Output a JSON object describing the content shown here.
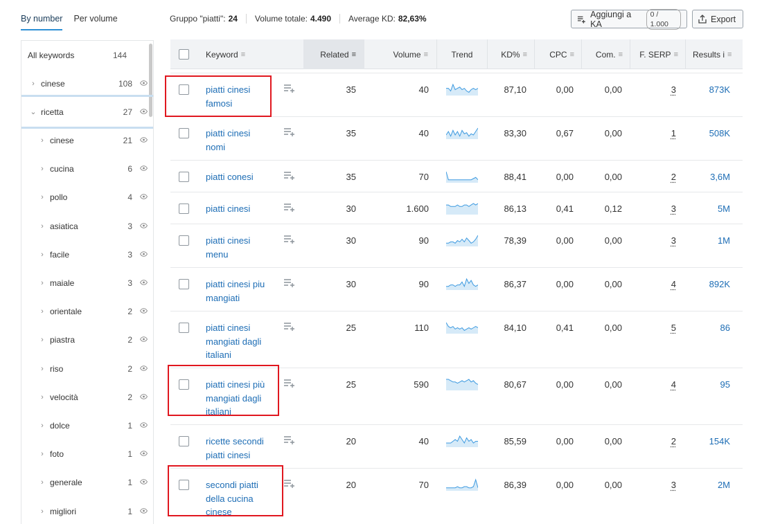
{
  "view_tabs": [
    {
      "label": "By number",
      "active": true
    },
    {
      "label": "Per volume",
      "active": false
    }
  ],
  "summary": {
    "group_label": "Gruppo \"piatti\":",
    "group_value": "24",
    "volume_label": "Volume totale:",
    "volume_value": "4.490",
    "kd_label": "Average KD:",
    "kd_value": "82,63%"
  },
  "toolbar": {
    "add_ka_label": "Aggiungi a KA",
    "add_ka_counter": "0 / 1.000",
    "export_label": "Export"
  },
  "groups": {
    "all": {
      "label": "All keywords",
      "count": "144"
    },
    "items": [
      {
        "label": "cinese",
        "count": "108",
        "level": 1,
        "expanded": false
      },
      {
        "label": "ricetta",
        "count": "27",
        "level": 1,
        "expanded": true
      },
      {
        "label": "cinese",
        "count": "21",
        "level": 2
      },
      {
        "label": "cucina",
        "count": "6",
        "level": 2
      },
      {
        "label": "pollo",
        "count": "4",
        "level": 2
      },
      {
        "label": "asiatica",
        "count": "3",
        "level": 2
      },
      {
        "label": "facile",
        "count": "3",
        "level": 2
      },
      {
        "label": "maiale",
        "count": "3",
        "level": 2
      },
      {
        "label": "orientale",
        "count": "2",
        "level": 2
      },
      {
        "label": "piastra",
        "count": "2",
        "level": 2
      },
      {
        "label": "riso",
        "count": "2",
        "level": 2
      },
      {
        "label": "velocità",
        "count": "2",
        "level": 2
      },
      {
        "label": "dolce",
        "count": "1",
        "level": 2
      },
      {
        "label": "foto",
        "count": "1",
        "level": 2
      },
      {
        "label": "generale",
        "count": "1",
        "level": 2
      },
      {
        "label": "migliori",
        "count": "1",
        "level": 2
      }
    ]
  },
  "table": {
    "columns": {
      "keyword": "Keyword",
      "related": "Related",
      "volume": "Volume",
      "trend": "Trend",
      "kd": "KD%",
      "cpc": "CPC",
      "com": "Com.",
      "serp": "F. SERP",
      "results": "Results i"
    },
    "rows": [
      {
        "keyword": [
          "piatti cinesi",
          "famosi"
        ],
        "related": "35",
        "volume": "40",
        "trend": [
          5,
          5,
          3,
          8,
          4,
          5,
          6,
          4,
          5,
          3,
          2,
          4,
          5,
          4,
          5
        ],
        "kd": "87,10",
        "cpc": "0,00",
        "com": "0,00",
        "serp": "3",
        "results": "873K",
        "highlighted": true
      },
      {
        "keyword": [
          "piatti cinesi",
          "nomi"
        ],
        "related": "35",
        "volume": "40",
        "trend": [
          3,
          6,
          2,
          7,
          3,
          6,
          2,
          7,
          4,
          5,
          2,
          4,
          3,
          6,
          9
        ],
        "kd": "83,30",
        "cpc": "0,67",
        "com": "0,00",
        "serp": "1",
        "results": "508K",
        "highlighted": false
      },
      {
        "keyword": [
          "piatti conesi"
        ],
        "related": "35",
        "volume": "70",
        "trend": [
          9,
          2,
          2,
          2,
          2,
          2,
          2,
          2,
          2,
          2,
          2,
          2,
          3,
          4,
          2
        ],
        "kd": "88,41",
        "cpc": "0,00",
        "com": "0,00",
        "serp": "2",
        "results": "3,6M",
        "highlighted": false
      },
      {
        "keyword": [
          "piatti cinesi"
        ],
        "related": "30",
        "volume": "1.600",
        "trend": [
          6,
          6,
          5,
          5,
          5,
          6,
          5,
          5,
          6,
          6,
          5,
          6,
          7,
          6,
          7
        ],
        "kd": "86,13",
        "cpc": "0,41",
        "com": "0,12",
        "serp": "3",
        "results": "5M",
        "highlighted": false
      },
      {
        "keyword": [
          "piatti cinesi",
          "menu"
        ],
        "related": "30",
        "volume": "90",
        "trend": [
          2,
          2,
          3,
          3,
          2,
          4,
          3,
          5,
          3,
          6,
          4,
          2,
          3,
          5,
          8
        ],
        "kd": "78,39",
        "cpc": "0,00",
        "com": "0,00",
        "serp": "3",
        "results": "1M",
        "highlighted": false
      },
      {
        "keyword": [
          "piatti cinesi piu",
          "mangiati"
        ],
        "related": "30",
        "volume": "90",
        "trend": [
          2,
          2,
          3,
          3,
          2,
          3,
          3,
          5,
          2,
          7,
          4,
          6,
          3,
          2,
          3
        ],
        "kd": "86,37",
        "cpc": "0,00",
        "com": "0,00",
        "serp": "4",
        "results": "892K",
        "highlighted": false
      },
      {
        "keyword": [
          "piatti cinesi",
          "mangiati dagli",
          "italiani"
        ],
        "related": "25",
        "volume": "110",
        "trend": [
          8,
          5,
          4,
          5,
          3,
          4,
          3,
          4,
          2,
          3,
          4,
          3,
          4,
          5,
          4
        ],
        "kd": "84,10",
        "cpc": "0,41",
        "com": "0,00",
        "serp": "5",
        "results": "86",
        "highlighted": false
      },
      {
        "keyword": [
          "piatti cinesi più",
          "mangiati dagli",
          "italiani"
        ],
        "related": "25",
        "volume": "590",
        "trend": [
          8,
          8,
          7,
          6,
          6,
          5,
          6,
          7,
          6,
          7,
          8,
          6,
          7,
          5,
          4
        ],
        "kd": "80,67",
        "cpc": "0,00",
        "com": "0,00",
        "serp": "4",
        "results": "95",
        "highlighted": true
      },
      {
        "keyword": [
          "ricette secondi",
          "piatti cinesi"
        ],
        "related": "20",
        "volume": "40",
        "trend": [
          2,
          2,
          2,
          3,
          4,
          3,
          6,
          4,
          2,
          5,
          3,
          4,
          2,
          3,
          3
        ],
        "kd": "85,59",
        "cpc": "0,00",
        "com": "0,00",
        "serp": "2",
        "results": "154K",
        "highlighted": false
      },
      {
        "keyword": [
          "secondi piatti",
          "della cucina",
          "cinese"
        ],
        "related": "20",
        "volume": "70",
        "trend": [
          2,
          2,
          2,
          2,
          2,
          3,
          2,
          2,
          3,
          3,
          2,
          2,
          3,
          9,
          2
        ],
        "kd": "86,39",
        "cpc": "0,00",
        "com": "0,00",
        "serp": "3",
        "results": "2M",
        "highlighted": true
      }
    ]
  },
  "colors": {
    "link": "#1d6db5",
    "highlight_border": "#e0171f",
    "trend_line": "#3d9ae0",
    "trend_fill": "#d6eaf8"
  },
  "icons": {
    "add_to_list": "list-plus-icon",
    "export": "export-icon",
    "eye": "eye-icon",
    "chevron": "chevron-icon",
    "sort": "sort-icon"
  }
}
